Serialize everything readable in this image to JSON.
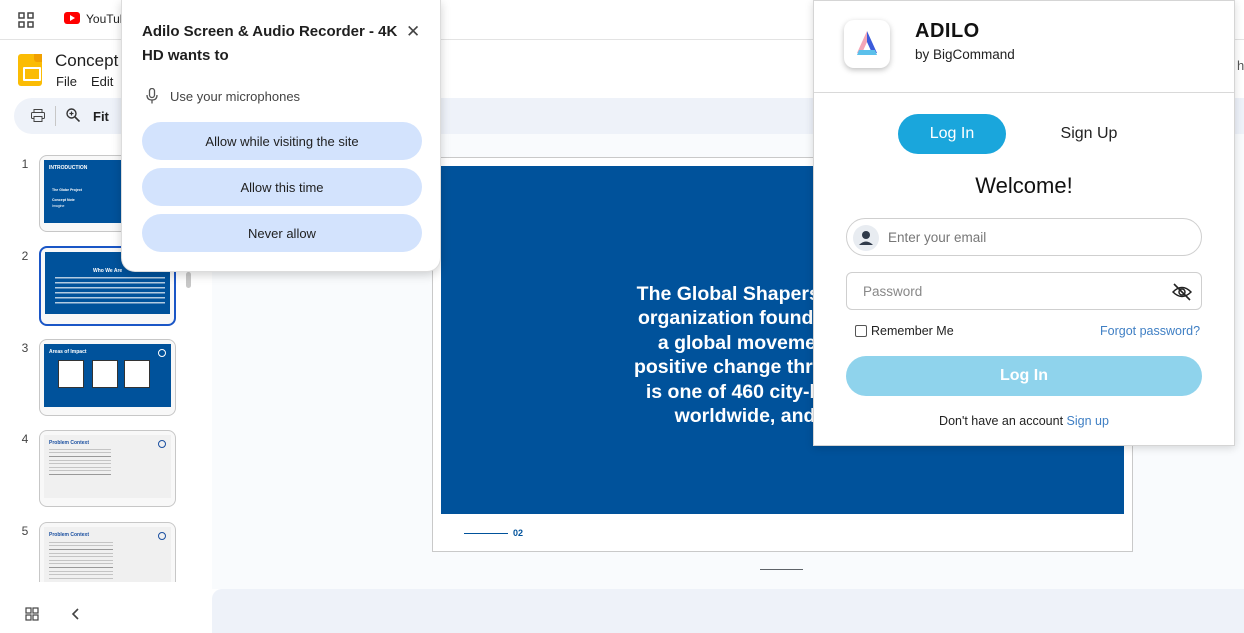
{
  "bookmarks": {
    "youtube_label": "YouTul"
  },
  "slides_app": {
    "doc_title": "Concept",
    "menu": [
      "File",
      "Edit"
    ],
    "toolbar": {
      "fit_label": "Fit"
    },
    "thumbnails": [
      {
        "number": "1",
        "title": "INTRODUCTION",
        "lines": [
          "The Globe Project",
          "Concept Note",
          "Imagine"
        ]
      },
      {
        "number": "2",
        "title": "Who We Are"
      },
      {
        "number": "3",
        "title": "Areas of Impact"
      },
      {
        "number": "4",
        "title": "Problem Context"
      },
      {
        "number": "5",
        "title": "Problem Context"
      }
    ],
    "slide": {
      "title": "Who We A",
      "body_lines": [
        "The Global Shapers Community i",
        "organization founded by the Wor",
        "a global movement of young",
        "positive change through dialogue",
        "is one of 460 city-based hubs a",
        "worldwide, and one of 11"
      ],
      "page_number": "02"
    }
  },
  "permission_popup": {
    "title": "Adilo Screen & Audio Recorder - 4K HD wants to",
    "request": "Use your microphones",
    "buttons": [
      "Allow while visiting the site",
      "Allow this time",
      "Never allow"
    ],
    "close_glyph": "✕"
  },
  "adilo": {
    "name": "ADILO",
    "by": "by BigCommand",
    "tab_login": "Log In",
    "tab_signup": "Sign Up",
    "welcome": "Welcome!",
    "email_placeholder": "Enter your email",
    "password_placeholder": "Password",
    "remember": "Remember Me",
    "forgot": "Forgot password?",
    "login_button": "Log In",
    "no_account": "Don't have an account",
    "signup_link": "Sign up",
    "colors": {
      "primary": "#1aa6dc",
      "disabled_button": "#8fd3ec",
      "link": "#3f7fc4"
    }
  },
  "colors": {
    "slide_blue": "#00529b",
    "permission_button": "#d3e3fd",
    "toolbar_bg": "#eef2f9"
  }
}
